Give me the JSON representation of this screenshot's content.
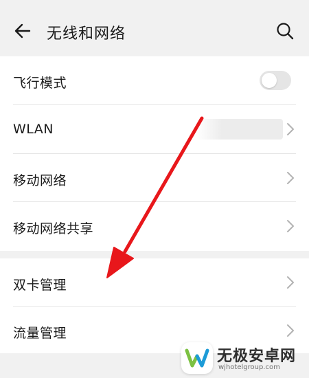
{
  "header": {
    "back_icon": "back-arrow-icon",
    "title": "无线和网络",
    "search_icon": "search-icon"
  },
  "settings": {
    "group1": [
      {
        "label": "飞行模式",
        "control": "toggle",
        "toggle_on": false
      },
      {
        "label": "WLAN",
        "control": "chevron",
        "value_obscured": true
      },
      {
        "label": "移动网络",
        "control": "chevron"
      },
      {
        "label": "移动网络共享",
        "control": "chevron"
      }
    ],
    "group2": [
      {
        "label": "双卡管理",
        "control": "chevron"
      },
      {
        "label": "流量管理",
        "control": "chevron"
      }
    ]
  },
  "annotation": {
    "type": "arrow",
    "color": "#e8171b",
    "from_item": "WLAN",
    "points_to_item": "双卡管理"
  },
  "watermark": {
    "title": "无极安卓网",
    "url": "wjhotelgroup.com",
    "logo_colors": [
      "#7cc142",
      "#1d9bd7"
    ]
  },
  "colors": {
    "background": "#f1f1f1",
    "card": "#ffffff",
    "divider": "#e6e6e6",
    "text": "#1a1a1a",
    "chevron": "#b3b3b3",
    "toggle_off": "#e5e5e5"
  }
}
